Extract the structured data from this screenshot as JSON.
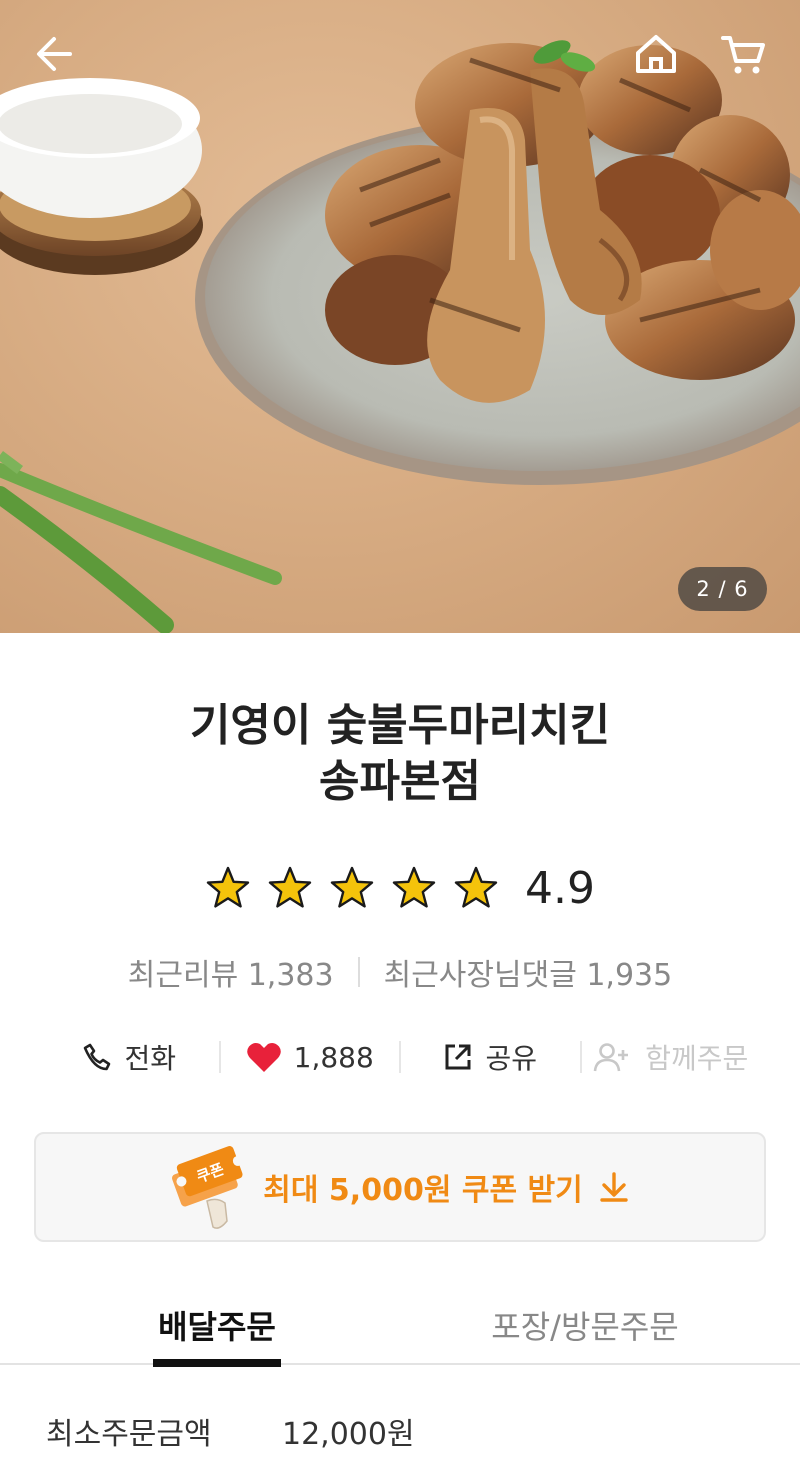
{
  "hero": {
    "pager": "2 / 6"
  },
  "store": {
    "name_line1": "기영이 숯불두마리치킨",
    "name_line2": "송파본점",
    "rating": "4.9",
    "stars_filled": 5,
    "recent_reviews": "최근리뷰 1,383",
    "owner_replies": "최근사장님댓글 1,935"
  },
  "actions": {
    "phone_label": "전화",
    "like_count": "1,888",
    "share_label": "공유",
    "group_order_label": "함께주문"
  },
  "coupon": {
    "badge": "쿠폰",
    "label": "최대 5,000원 쿠폰 받기"
  },
  "tabs": {
    "delivery": "배달주문",
    "pickup": "포장/방문주문"
  },
  "min_order": {
    "label": "최소주문금액",
    "value": "12,000원"
  },
  "colors": {
    "accent": "#f08a14",
    "heart": "#e8213a",
    "star": "#f4c30b"
  }
}
